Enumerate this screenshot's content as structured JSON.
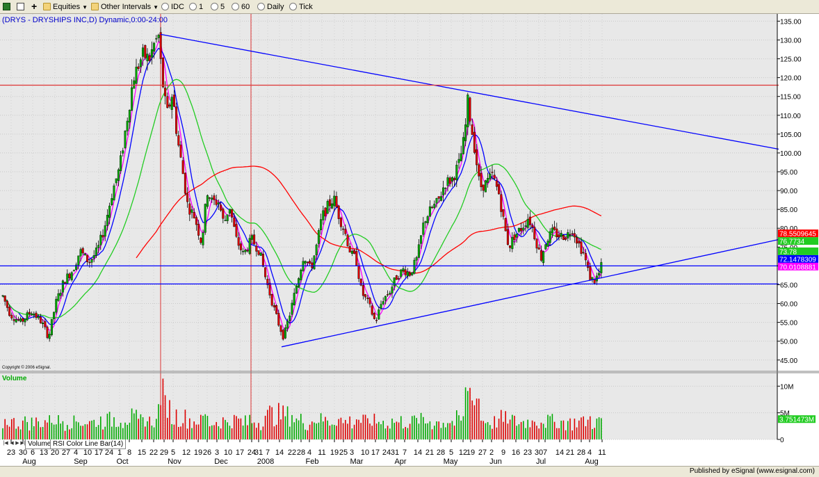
{
  "toolbar": {
    "equities": "Equities",
    "other_intervals": "Other Intervals",
    "idc": "IDC",
    "i1": "1",
    "i5": "5",
    "i60": "60",
    "daily": "Daily",
    "tick": "Tick"
  },
  "chart_header": "(DRYS - DRYSHIPS INC,D) Dynamic,0:00-24:00",
  "copyright": "Copyright © 2006 eSignal.",
  "volume_title": "Volume",
  "tabs": {
    "volume": "Volume",
    "rsi": "RSI Color Line Bar(14)"
  },
  "published": "Published by eSignal (www.esignal.com)",
  "colors": {
    "up": "#00aa00",
    "down": "#dd0000",
    "ma_blue": "#0000ff",
    "ma_green": "#22cc22",
    "ma_red": "#ff0000",
    "ma_magenta": "#ff00ff",
    "trend": "#0000ff"
  },
  "chart_data": {
    "type": "candlestick",
    "price_axis": {
      "ylim": [
        42,
        136
      ],
      "ticks": [
        "135.00",
        "130.00",
        "125.00",
        "120.00",
        "115.00",
        "110.00",
        "105.00",
        "100.00",
        "95.00",
        "90.00",
        "85.00",
        "80.00",
        "75.00",
        "70.00",
        "65.00",
        "60.00",
        "55.00",
        "50.00",
        "45.00"
      ]
    },
    "volume_axis": {
      "ylim": [
        0,
        12000000
      ],
      "ticks": [
        "10M",
        "5M",
        "0"
      ]
    },
    "x_range": [
      0,
      1120
    ],
    "x_ticks_top": [
      {
        "x": 16,
        "label": "23"
      },
      {
        "x": 33,
        "label": "30"
      },
      {
        "x": 47,
        "label": "6"
      },
      {
        "x": 63,
        "label": "13"
      },
      {
        "x": 79,
        "label": "20"
      },
      {
        "x": 95,
        "label": "27"
      },
      {
        "x": 109,
        "label": "4"
      },
      {
        "x": 126,
        "label": "10"
      },
      {
        "x": 142,
        "label": "17"
      },
      {
        "x": 157,
        "label": "24"
      },
      {
        "x": 172,
        "label": "1"
      },
      {
        "x": 186,
        "label": "8"
      },
      {
        "x": 204,
        "label": "15"
      },
      {
        "x": 221,
        "label": "22"
      },
      {
        "x": 236,
        "label": "29"
      },
      {
        "x": 249,
        "label": "5"
      },
      {
        "x": 268,
        "label": "12"
      },
      {
        "x": 285,
        "label": "19"
      },
      {
        "x": 298,
        "label": "26"
      },
      {
        "x": 312,
        "label": "3"
      },
      {
        "x": 328,
        "label": "10"
      },
      {
        "x": 345,
        "label": "17"
      },
      {
        "x": 362,
        "label": "24"
      },
      {
        "x": 372,
        "label": "31"
      },
      {
        "x": 385,
        "label": "7"
      },
      {
        "x": 402,
        "label": "14"
      },
      {
        "x": 420,
        "label": "22"
      },
      {
        "x": 433,
        "label": "28"
      },
      {
        "x": 445,
        "label": "4"
      },
      {
        "x": 463,
        "label": "11"
      },
      {
        "x": 481,
        "label": "19"
      },
      {
        "x": 494,
        "label": "25"
      },
      {
        "x": 506,
        "label": "3"
      },
      {
        "x": 525,
        "label": "10"
      },
      {
        "x": 540,
        "label": "17"
      },
      {
        "x": 556,
        "label": "24"
      },
      {
        "x": 568,
        "label": "31"
      },
      {
        "x": 582,
        "label": "7"
      },
      {
        "x": 601,
        "label": "14"
      },
      {
        "x": 618,
        "label": "21"
      },
      {
        "x": 634,
        "label": "28"
      },
      {
        "x": 649,
        "label": "5"
      },
      {
        "x": 666,
        "label": "12"
      },
      {
        "x": 677,
        "label": "19"
      },
      {
        "x": 694,
        "label": "27"
      },
      {
        "x": 707,
        "label": "2"
      },
      {
        "x": 724,
        "label": "9"
      },
      {
        "x": 742,
        "label": "16"
      },
      {
        "x": 759,
        "label": "23"
      },
      {
        "x": 775,
        "label": "30"
      },
      {
        "x": 784,
        "label": "7"
      },
      {
        "x": 805,
        "label": "14"
      },
      {
        "x": 820,
        "label": "21"
      },
      {
        "x": 836,
        "label": "28"
      },
      {
        "x": 848,
        "label": "4"
      },
      {
        "x": 866,
        "label": "11"
      }
    ],
    "x_ticks_bottom": [
      {
        "x": 42,
        "label": "Aug"
      },
      {
        "x": 116,
        "label": "Sep"
      },
      {
        "x": 176,
        "label": "Oct"
      },
      {
        "x": 251,
        "label": "Nov"
      },
      {
        "x": 318,
        "label": "Dec"
      },
      {
        "x": 382,
        "label": "2008"
      },
      {
        "x": 449,
        "label": "Feb"
      },
      {
        "x": 513,
        "label": "Mar"
      },
      {
        "x": 576,
        "label": "Apr"
      },
      {
        "x": 648,
        "label": "May"
      },
      {
        "x": 713,
        "label": "Jun"
      },
      {
        "x": 778,
        "label": "Jul"
      },
      {
        "x": 851,
        "label": "Aug"
      }
    ],
    "price_path": [
      [
        4,
        62
      ],
      [
        15,
        57
      ],
      [
        30,
        55
      ],
      [
        45,
        58
      ],
      [
        60,
        55
      ],
      [
        70,
        51
      ],
      [
        80,
        60
      ],
      [
        92,
        66
      ],
      [
        105,
        69
      ],
      [
        115,
        74
      ],
      [
        128,
        71
      ],
      [
        140,
        74
      ],
      [
        150,
        80
      ],
      [
        162,
        90
      ],
      [
        172,
        96
      ],
      [
        182,
        108
      ],
      [
        192,
        120
      ],
      [
        205,
        126
      ],
      [
        215,
        125
      ],
      [
        222,
        129
      ],
      [
        228,
        131
      ],
      [
        233,
        120
      ],
      [
        240,
        110
      ],
      [
        248,
        116
      ],
      [
        255,
        104
      ],
      [
        262,
        96
      ],
      [
        270,
        86
      ],
      [
        280,
        83
      ],
      [
        290,
        76
      ],
      [
        298,
        90
      ],
      [
        305,
        87
      ],
      [
        315,
        87
      ],
      [
        322,
        81
      ],
      [
        330,
        86
      ],
      [
        340,
        77
      ],
      [
        350,
        73
      ],
      [
        362,
        77
      ],
      [
        373,
        74
      ],
      [
        383,
        66
      ],
      [
        392,
        60
      ],
      [
        400,
        55
      ],
      [
        408,
        51
      ],
      [
        418,
        58
      ],
      [
        428,
        66
      ],
      [
        437,
        73
      ],
      [
        447,
        69
      ],
      [
        455,
        75
      ],
      [
        463,
        83
      ],
      [
        472,
        86
      ],
      [
        480,
        88
      ],
      [
        488,
        83
      ],
      [
        496,
        79
      ],
      [
        505,
        73
      ],
      [
        512,
        72
      ],
      [
        520,
        63
      ],
      [
        530,
        60
      ],
      [
        540,
        55
      ],
      [
        550,
        61
      ],
      [
        560,
        63
      ],
      [
        570,
        67
      ],
      [
        580,
        69
      ],
      [
        590,
        68
      ],
      [
        600,
        72
      ],
      [
        610,
        82
      ],
      [
        620,
        85
      ],
      [
        630,
        87
      ],
      [
        640,
        92
      ],
      [
        650,
        93
      ],
      [
        660,
        97
      ],
      [
        668,
        104
      ],
      [
        673,
        114
      ],
      [
        677,
        108
      ],
      [
        683,
        101
      ],
      [
        690,
        91
      ],
      [
        700,
        92
      ],
      [
        708,
        94
      ],
      [
        718,
        89
      ],
      [
        726,
        80
      ],
      [
        732,
        75
      ],
      [
        740,
        78
      ],
      [
        750,
        80
      ],
      [
        760,
        83
      ],
      [
        766,
        80
      ],
      [
        772,
        76
      ],
      [
        778,
        72
      ],
      [
        786,
        77
      ],
      [
        795,
        79
      ],
      [
        805,
        78
      ],
      [
        815,
        78
      ],
      [
        823,
        80
      ],
      [
        832,
        76
      ],
      [
        840,
        73
      ],
      [
        848,
        67
      ],
      [
        855,
        66
      ],
      [
        862,
        68
      ],
      [
        868,
        72
      ]
    ],
    "drawn_lines": [
      {
        "name": "upper-trendline",
        "color": "#0000ff",
        "x1": 231,
        "y1": 131.5,
        "x2": 1120,
        "y2": 101
      },
      {
        "name": "lower-trendline",
        "color": "#0000ff",
        "x1": 405,
        "y1": 48.5,
        "x2": 1120,
        "y2": 77
      },
      {
        "name": "horizontal-70",
        "color": "#0000ff",
        "x1": 0,
        "y1": 70,
        "x2": 1120,
        "y2": 70
      },
      {
        "name": "horizontal-65",
        "color": "#0000ff",
        "x1": 0,
        "y1": 65.2,
        "x2": 1120,
        "y2": 65.2
      },
      {
        "name": "horizontal-118",
        "color": "#dd3333",
        "x1": 0,
        "y1": 118,
        "x2": 1120,
        "y2": 118
      }
    ],
    "vlines": [
      {
        "x": 231,
        "color": "#dd3333"
      },
      {
        "x": 361,
        "color": "#dd3333"
      }
    ],
    "ma_series": [
      {
        "name": "ma-magenta",
        "color": "#ff00ff",
        "period": 4
      },
      {
        "name": "ma-blue",
        "color": "#0000ff",
        "period": 8
      },
      {
        "name": "ma-green",
        "color": "#22cc22",
        "period": 24
      },
      {
        "name": "ma-red",
        "color": "#ff0000",
        "period": 70
      }
    ],
    "price_labels": [
      {
        "text": "78.5509645",
        "value": 78.55,
        "color": "#ff0000"
      },
      {
        "text": "76.7734",
        "value": 76.77,
        "color": "#22cc22"
      },
      {
        "text": "73.78",
        "value": 73.78,
        "color": "#22cc22"
      },
      {
        "text": "72.1478309",
        "value": 72.15,
        "color": "#0000ff"
      },
      {
        "text": "70.0108881",
        "value": 70.01,
        "color": "#ff00ff"
      }
    ],
    "volume_label": {
      "text": "3.751473M",
      "value": 3751473,
      "color": "#22cc22"
    }
  }
}
